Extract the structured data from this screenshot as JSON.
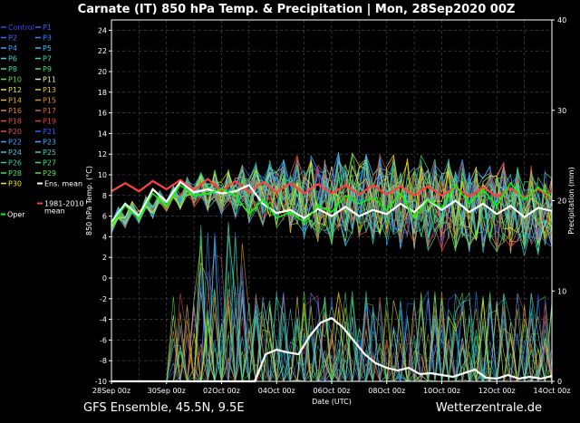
{
  "title": "Carnate  (IT)  850 hPa Temp. & Precipitation | Mon, 28Sep2020 00Z",
  "footer": {
    "left": "GFS Ensemble, 45.5N, 9.5E",
    "right": "Wetterzentrale.de"
  },
  "chart_data": {
    "type": "line",
    "ylabel_left": "850 hPa Temp. (°C)",
    "ylabel_right": "Precipitation (mm)",
    "xlabel": "Date (UTC)",
    "ylim_left": [
      -10,
      25
    ],
    "ylim_right": [
      0,
      40
    ],
    "yticks_left": [
      "24",
      "22",
      "20",
      "18",
      "16",
      "14",
      "12",
      "10",
      "8",
      "6",
      "4",
      "2",
      "0",
      "-2",
      "-4",
      "-6",
      "-8",
      "-10"
    ],
    "yticks_right": [
      "40",
      "30",
      "20",
      "10",
      "0"
    ],
    "xticks": [
      "28Sep 00z",
      "30Sep 00z",
      "02Oct 00z",
      "04Oct 00z",
      "06Oct 00z",
      "08Oct 00z",
      "10Oct 00z",
      "12Oct 00z",
      "14Oct 00z"
    ],
    "grid": true,
    "legend": [
      {
        "label": "Control",
        "color": "#4040ff"
      },
      {
        "label": "P1",
        "color": "#4060ff"
      },
      {
        "label": "P2",
        "color": "#3a6cff"
      },
      {
        "label": "P3",
        "color": "#2a8cff"
      },
      {
        "label": "P4",
        "color": "#30a0ff"
      },
      {
        "label": "P5",
        "color": "#40c0ff"
      },
      {
        "label": "P6",
        "color": "#40d0e0"
      },
      {
        "label": "P7",
        "color": "#30e0b0"
      },
      {
        "label": "P8",
        "color": "#30e090"
      },
      {
        "label": "P9",
        "color": "#40e060"
      },
      {
        "label": "P10",
        "color": "#50e040"
      },
      {
        "label": "P11",
        "color": "#f0f090"
      },
      {
        "label": "P12",
        "color": "#e0e040"
      },
      {
        "label": "P13",
        "color": "#e0c040"
      },
      {
        "label": "P14",
        "color": "#e0b030"
      },
      {
        "label": "P15",
        "color": "#e09030"
      },
      {
        "label": "P16",
        "color": "#e08030"
      },
      {
        "label": "P17",
        "color": "#e06030"
      },
      {
        "label": "P18",
        "color": "#e05030"
      },
      {
        "label": "P19",
        "color": "#e04040"
      },
      {
        "label": "P20",
        "color": "#e04860"
      },
      {
        "label": "P21",
        "color": "#3060ff"
      },
      {
        "label": "P22",
        "color": "#40a0ff"
      },
      {
        "label": "P23",
        "color": "#40b0ff"
      },
      {
        "label": "P24",
        "color": "#40c0e0"
      },
      {
        "label": "P25",
        "color": "#40d0c0"
      },
      {
        "label": "P26",
        "color": "#40d0a0"
      },
      {
        "label": "P27",
        "color": "#40e080"
      },
      {
        "label": "P28",
        "color": "#40e060"
      },
      {
        "label": "P29",
        "color": "#60e040"
      },
      {
        "label": "P30",
        "color": "#f0f000"
      },
      {
        "label": "Ens. mean",
        "color": "#ffffff"
      },
      {
        "label": "1981-2010 mean",
        "color": "#ff4040"
      },
      {
        "label": "Oper",
        "color": "#00ff00"
      }
    ],
    "series": [
      {
        "name": "1981-2010 mean",
        "axis": "left",
        "color": "#ff4040",
        "x": [
          0,
          0.5,
          1,
          1.5,
          2,
          2.5,
          3,
          3.5,
          4,
          4.5,
          5,
          5.5,
          6,
          6.5,
          7,
          7.5,
          8,
          8.5,
          9,
          9.5,
          10,
          10.5,
          11,
          11.5,
          12,
          12.5,
          13,
          13.5,
          14,
          14.5,
          15,
          15.5,
          16
        ],
        "y": [
          8.4,
          9.2,
          8.4,
          9.4,
          8.6,
          9.5,
          8.5,
          9.6,
          8.4,
          9.4,
          8.3,
          9.3,
          8.3,
          9.2,
          8.2,
          9.1,
          8.2,
          9.0,
          8.1,
          9.0,
          8.1,
          8.9,
          8.0,
          8.9,
          8.0,
          8.8,
          7.9,
          8.8,
          7.9,
          8.7,
          7.8,
          8.6,
          7.8
        ]
      },
      {
        "name": "Ens. mean",
        "axis": "left",
        "color": "#ffffff",
        "x": [
          0,
          0.5,
          1,
          1.5,
          2,
          2.5,
          3,
          3.5,
          4,
          4.5,
          5,
          5.5,
          6,
          6.5,
          7,
          7.5,
          8,
          8.5,
          9,
          9.5,
          10,
          10.5,
          11,
          11.5,
          12,
          12.5,
          13,
          13.5,
          14,
          14.5,
          15,
          15.5,
          16
        ],
        "y": [
          5.4,
          7.2,
          6.0,
          8.6,
          7.4,
          9.3,
          8.3,
          8.6,
          8.2,
          8.4,
          9.0,
          7.2,
          6.3,
          6.6,
          5.8,
          6.7,
          6.0,
          6.9,
          6.0,
          6.6,
          6.2,
          7.2,
          6.4,
          7.6,
          6.6,
          7.5,
          6.4,
          7.2,
          6.2,
          7.0,
          5.9,
          6.8,
          6.5
        ]
      },
      {
        "name": "Ens. mean precip",
        "axis": "right",
        "color": "#ffffff",
        "x": [
          0,
          1,
          2,
          3,
          3.5,
          3.9,
          4.2,
          4.5,
          4.8,
          5.2,
          5.6,
          6,
          6.4,
          6.8,
          7.2,
          7.6,
          8,
          8.4,
          8.8,
          9.2,
          9.6,
          10,
          10.4,
          10.8,
          11.2,
          11.6,
          12,
          12.4,
          12.8,
          13.2,
          13.6,
          14,
          14.4,
          14.8,
          15.2,
          15.6,
          16
        ],
        "y": [
          0,
          0,
          0,
          0,
          0,
          0,
          0,
          0,
          0,
          0,
          3,
          3.5,
          3.2,
          3,
          5,
          6.5,
          7,
          6,
          4.5,
          3,
          2,
          1.5,
          1.2,
          1.5,
          0.8,
          0.9,
          0.7,
          0.5,
          0.9,
          1.3,
          0.4,
          0.3,
          0.7,
          0.3,
          0.5,
          0.3,
          0.6
        ]
      },
      {
        "name": "Oper",
        "axis": "left",
        "color": "#00ff00",
        "x": [
          0,
          0.5,
          1,
          1.5,
          2,
          2.5,
          3,
          3.5,
          4,
          4.5,
          5,
          5.5,
          6,
          6.5,
          7,
          7.5,
          8,
          8.5,
          9,
          9.5,
          10,
          10.5,
          11,
          11.5,
          12,
          12.5,
          13,
          13.5,
          14,
          14.5,
          15,
          15.5,
          16
        ],
        "y": [
          5.2,
          7.0,
          5.8,
          8.2,
          7.0,
          9.0,
          8.0,
          8.2,
          8.6,
          8.0,
          6.2,
          7.6,
          5.8,
          6.4,
          5.4,
          7.0,
          6.4,
          8.0,
          7.2,
          7.8,
          6.6,
          8.2,
          5.8,
          7.6,
          6.8,
          9.0,
          7.2,
          8.6,
          7.0,
          9.2,
          7.6,
          8.8,
          7.8
        ]
      }
    ]
  }
}
